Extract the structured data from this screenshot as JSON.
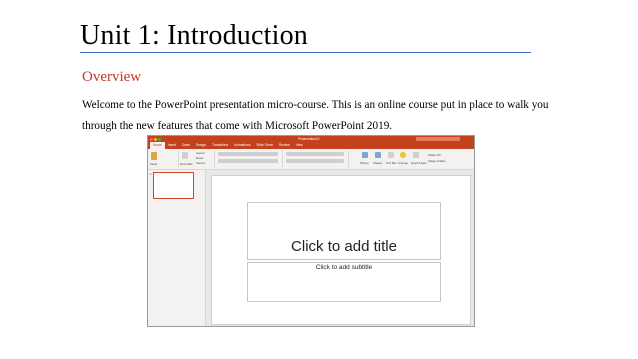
{
  "slide": {
    "title": "Unit 1: Introduction",
    "section_heading": "Overview",
    "body": "Welcome to the PowerPoint presentation micro-course. This is an online course put in place to walk you through the new features that come with Microsoft PowerPoint 2019.",
    "colors": {
      "title_rule": "#4472c4",
      "section_heading": "#c0392b"
    }
  },
  "screenshot": {
    "window_title": "Presentation10",
    "tabs": [
      "Home",
      "Insert",
      "Draw",
      "Design",
      "Transitions",
      "Animations",
      "Slide Show",
      "Review",
      "View"
    ],
    "active_tab": "Home",
    "share_label": "Share",
    "ribbon": {
      "paste": "Paste",
      "new_slide": "New Slide",
      "layout": "Layout",
      "reset": "Reset",
      "section": "Section",
      "convert_smartart": "Convert to SmartArt",
      "picture": "Picture",
      "shapes": "Shapes",
      "text_box": "Text Box",
      "arrange": "Arrange",
      "quick_styles": "Quick Styles",
      "shape_fill": "Shape Fill",
      "shape_outline": "Shape Outline"
    },
    "thumbnail_number": "1",
    "placeholder_title": "Click to add title",
    "placeholder_subtitle": "Click to add subtitle",
    "colors": {
      "app_bar": "#c4411d",
      "selection": "#d24726"
    }
  }
}
